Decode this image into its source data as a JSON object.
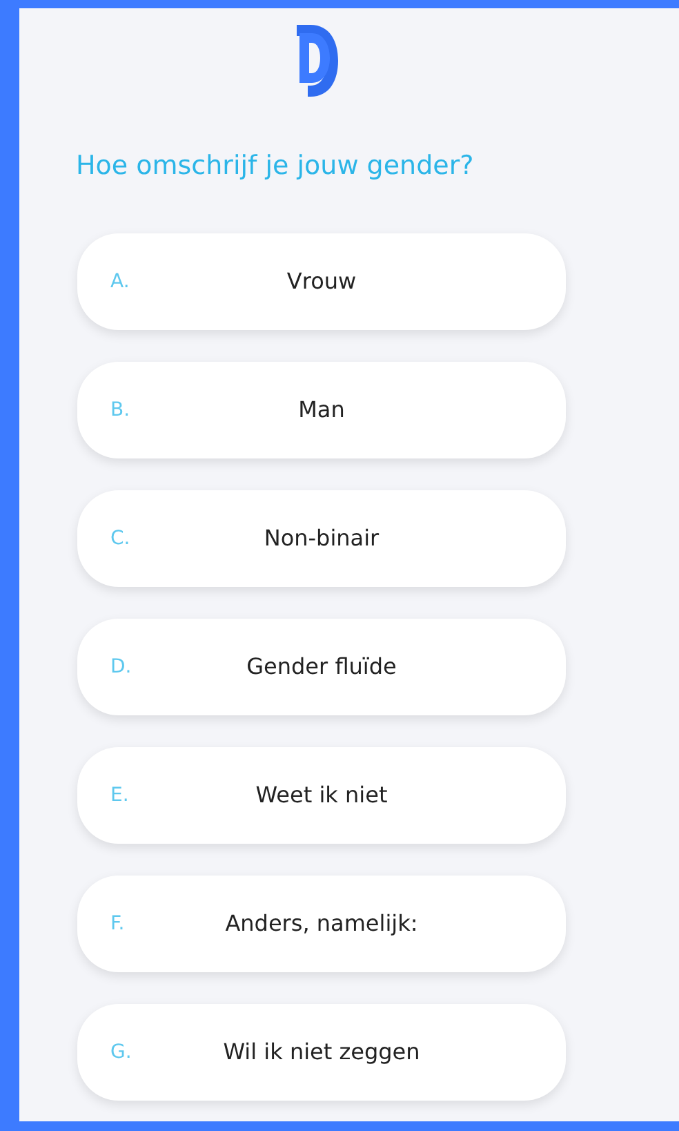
{
  "question": "Hoe omschrijf je jouw gender?",
  "options": [
    {
      "letter": "A.",
      "label": "Vrouw"
    },
    {
      "letter": "B.",
      "label": "Man"
    },
    {
      "letter": "C.",
      "label": "Non-binair"
    },
    {
      "letter": "D.",
      "label": "Gender fluïde"
    },
    {
      "letter": "E.",
      "label": "Weet ik niet"
    },
    {
      "letter": "F.",
      "label": "Anders, namelijk:"
    },
    {
      "letter": "G.",
      "label": "Wil ik niet zeggen"
    }
  ]
}
